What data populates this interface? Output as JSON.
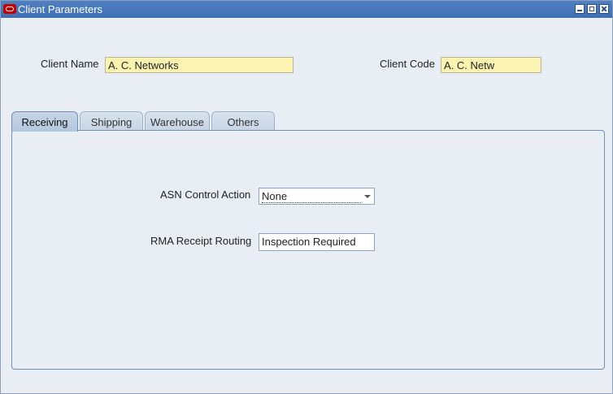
{
  "window": {
    "title": "Client Parameters"
  },
  "header": {
    "client_name_label": "Client Name",
    "client_name_value": "A. C. Networks",
    "client_code_label": "Client Code",
    "client_code_value": "A. C. Netw"
  },
  "tabs": [
    {
      "label": "Receiving",
      "active": true
    },
    {
      "label": "Shipping",
      "active": false
    },
    {
      "label": "Warehouse",
      "active": false
    },
    {
      "label": "Others",
      "active": false
    }
  ],
  "receiving": {
    "asn_label": "ASN Control Action",
    "asn_value": "None",
    "rma_label": "RMA Receipt Routing",
    "rma_value": "Inspection Required"
  },
  "colors": {
    "titlebar": "#4f80c2",
    "required_field": "#fdf3b0",
    "logo": "#c40000"
  }
}
